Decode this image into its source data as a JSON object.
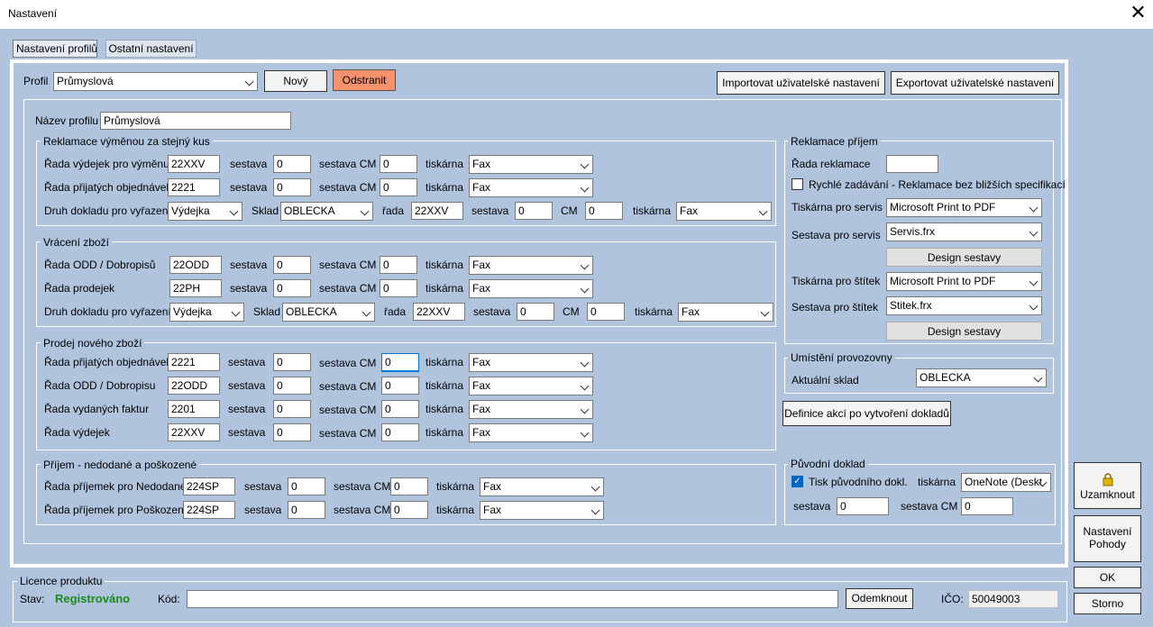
{
  "window": {
    "title": "Nastavení",
    "close_glyph": "✕"
  },
  "tabs": [
    {
      "label": "Nastavení profilů"
    },
    {
      "label": "Ostatní nastavení"
    }
  ],
  "top": {
    "profil_label": "Profil",
    "profil_value": "Průmyslová",
    "new_btn": "Nový",
    "delete_btn": "Odstranit",
    "import_btn": "Importovat uživatelské nastavení",
    "export_btn": "Exportovat uživatelské nastavení",
    "profile_name_label": "Název profilu",
    "profile_name_value": "Průmyslová"
  },
  "reklamace_vymena": {
    "title": "Reklamace výměnou za stejný kus",
    "rows": [
      {
        "label": "Řada výdejek pro výměnu",
        "rada": "22XXV",
        "sestava_label": "sestava",
        "sestava": "0",
        "cm_label": "sestava CM",
        "cm": "0",
        "tiskarna_label": "tiskárna",
        "tiskarna": "Fax"
      },
      {
        "label": "Řada přijatých objednávek",
        "rada": "2221",
        "sestava_label": "sestava",
        "sestava": "0",
        "cm_label": "sestava CM",
        "cm": "0",
        "tiskarna_label": "tiskárna",
        "tiskarna": "Fax"
      }
    ],
    "druh": {
      "label": "Druh dokladu pro vyřazení",
      "doklad": "Výdejka",
      "sklad_label": "Sklad",
      "sklad": "OBLECKA",
      "rada_label": "řada",
      "rada": "22XXV",
      "sestava_label": "sestava",
      "sestava": "0",
      "cm_label": "CM",
      "cm": "0",
      "tiskarna_label": "tiskárna",
      "tiskarna": "Fax"
    }
  },
  "vraceni": {
    "title": "Vrácení zboží",
    "rows": [
      {
        "label": "Řada ODD / Dobropisů",
        "rada": "22ODD",
        "sestava_label": "sestava",
        "sestava": "0",
        "cm_label": "sestava CM",
        "cm": "0",
        "tiskarna_label": "tiskárna",
        "tiskarna": "Fax"
      },
      {
        "label": "Řada prodejek",
        "rada": "22PH",
        "sestava_label": "sestava",
        "sestava": "0",
        "cm_label": "sestava CM",
        "cm": "0",
        "tiskarna_label": "tiskárna",
        "tiskarna": "Fax"
      }
    ],
    "druh": {
      "label": "Druh dokladu pro vyřazení",
      "doklad": "Výdejka",
      "sklad_label": "Sklad",
      "sklad": "OBLECKA",
      "rada_label": "řada",
      "rada": "22XXV",
      "sestava_label": "sestava",
      "sestava": "0",
      "cm_label": "CM",
      "cm": "0",
      "tiskarna_label": "tiskárna",
      "tiskarna": "Fax"
    }
  },
  "prodej": {
    "title": "Prodej nového zboží",
    "rows": [
      {
        "label": "Řada přijatých objednávek",
        "rada": "2221",
        "sestava_label": "sestava",
        "sestava": "0",
        "cm_label": "sestava CM",
        "cm": "0",
        "tiskarna_label": "tiskárna",
        "tiskarna": "Fax"
      },
      {
        "label": "Řada ODD / Dobropisu",
        "rada": "22ODD",
        "sestava_label": "sestava",
        "sestava": "0",
        "cm_label": "sestava CM",
        "cm": "0",
        "tiskarna_label": "tiskárna",
        "tiskarna": "Fax"
      },
      {
        "label": "Řada vydaných faktur",
        "rada": "2201",
        "sestava_label": "sestava",
        "sestava": "0",
        "cm_label": "sestava CM",
        "cm": "0",
        "tiskarna_label": "tiskárna",
        "tiskarna": "Fax"
      },
      {
        "label": "Řada výdejek",
        "rada": "22XXV",
        "sestava_label": "sestava",
        "sestava": "0",
        "cm_label": "sestava CM",
        "cm": "0",
        "tiskarna_label": "tiskárna",
        "tiskarna": "Fax"
      }
    ]
  },
  "prijem": {
    "title": "Příjem - nedodané a poškozené",
    "rows": [
      {
        "label": "Řada příjemek pro Nedodané",
        "rada": "224SP",
        "sestava_label": "sestava",
        "sestava": "0",
        "cm_label": "sestava CM",
        "cm": "0",
        "tiskarna_label": "tiskárna",
        "tiskarna": "Fax"
      },
      {
        "label": "Řada příjemek pro Poškozené",
        "rada": "224SP",
        "sestava_label": "sestava",
        "sestava": "0",
        "cm_label": "sestava CM",
        "cm": "0",
        "tiskarna_label": "tiskárna",
        "tiskarna": "Fax"
      }
    ]
  },
  "reklamace_prijem": {
    "title": "Reklamace příjem",
    "rada_label": "Řada reklamace",
    "rada_value": "",
    "quick_label": "Rychlé zadávání - Reklamace bez bližších specifikací",
    "quick_checked": false,
    "tisk_servis_label": "Tiskárna pro servis",
    "tisk_servis": "Microsoft Print to PDF",
    "sestava_servis_label": "Sestava pro servis",
    "sestava_servis": "Servis.frx",
    "design1": "Design sestavy",
    "tisk_stitek_label": "Tiskárna pro štítek",
    "tisk_stitek": "Microsoft Print to PDF",
    "sestava_stitek_label": "Sestava pro štítek",
    "sestava_stitek": "Stitek.frx",
    "design2": "Design sestavy"
  },
  "umisteni": {
    "title": "Umístění provozovny",
    "sklad_label": "Aktuální sklad",
    "sklad": "OBLECKA"
  },
  "definice_btn": "Definice akcí po vytvoření dokladů",
  "puvodni": {
    "title": "Původní doklad",
    "tisk_label": "Tisk původního dokl.",
    "tisk_checked": true,
    "tiskarna_label": "tiskárna",
    "tiskarna": "OneNote (Deskt",
    "sestava_label": "sestava",
    "sestava": "0",
    "cm_label": "sestava CM",
    "cm": "0"
  },
  "side": {
    "lock_btn": "Uzamknout",
    "pohoda_btn": "Nastavení Pohody",
    "ok_btn": "OK",
    "storno_btn": "Storno"
  },
  "licence": {
    "title": "Licence produktu",
    "stav_label": "Stav:",
    "stav_value": "Registrováno",
    "kod_label": "Kód:",
    "kod_value": "",
    "unlock_btn": "Odemknout",
    "ico_label": "IČO:",
    "ico_value": "50049003"
  }
}
